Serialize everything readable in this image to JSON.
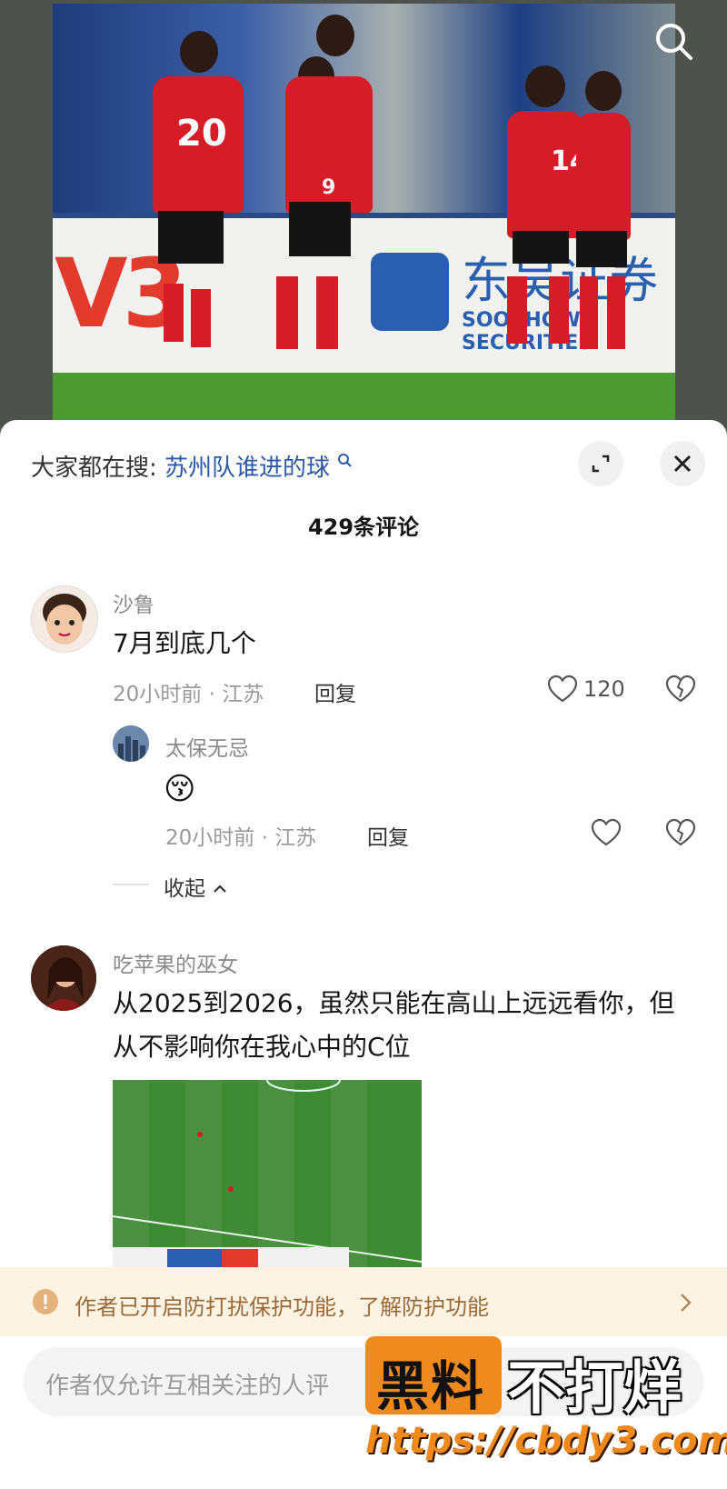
{
  "hot_search": {
    "prefix": "大家都在搜:",
    "query": "苏州队谁进的球"
  },
  "comments_count": "429条评论",
  "comments": [
    {
      "user": "沙鲁",
      "text": "7月到底几个",
      "meta": "20小时前 · 江苏",
      "reply_label": "回复",
      "likes": "120"
    },
    {
      "user": "吃苹果的巫女",
      "text": "从2025到2026，虽然只能在高山上远远看你，但从不影响你在我心中的C位",
      "meta": "",
      "reply_label": ""
    }
  ],
  "sub_reply": {
    "user": "太保无忌",
    "emoji": "😚",
    "meta": "20小时前 · 江苏",
    "reply_label": "回复"
  },
  "collapse_label": "收起",
  "protect_notice": "作者已开启防打扰保护功能，了解防护功能",
  "input_placeholder": "作者仅允许互相关注的人评",
  "photo": {
    "board_left": "V3",
    "board_cn": "东吴证券",
    "board_en": "SOOCHOW SECURITIES",
    "jersey_1": "20",
    "jersey_2": "14",
    "jersey_3": "9"
  },
  "watermark": {
    "tag": "黑料",
    "text": "不打烊",
    "url": "https://cbdy3.com"
  },
  "colors": {
    "accent": "#2b58a8",
    "notice_bg": "#fdf3e3",
    "notice_text": "#9a6a3a",
    "jersey": "#d61c26"
  }
}
